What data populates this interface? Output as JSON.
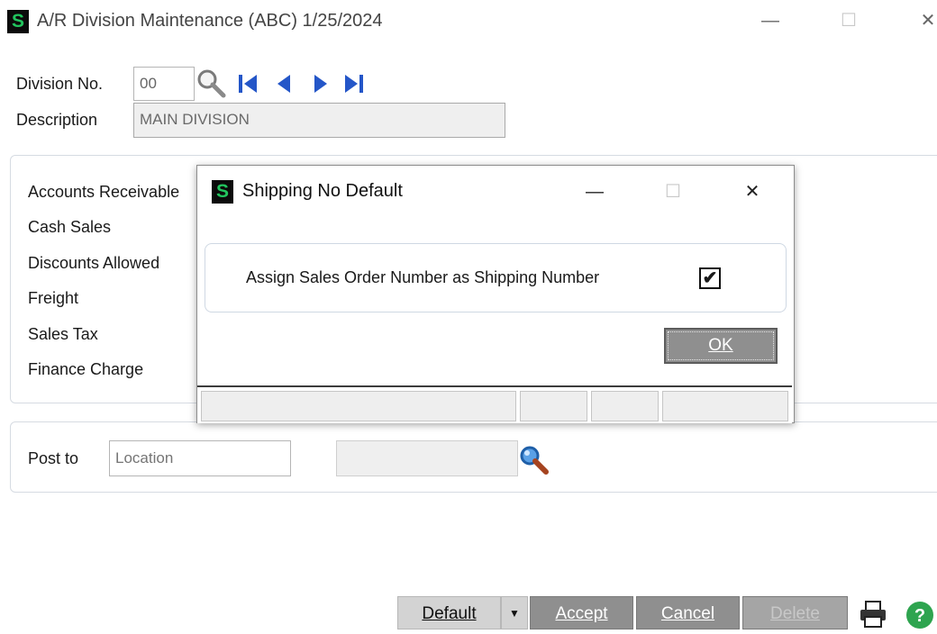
{
  "window": {
    "title": "A/R Division Maintenance (ABC) 1/25/2024",
    "logo_letter": "S",
    "controls": {
      "minimize": "—",
      "maximize": "☐",
      "close": "✕"
    }
  },
  "form": {
    "division_label": "Division No.",
    "division_value": "00",
    "description_label": "Description",
    "description_value": "MAIN DIVISION"
  },
  "accounts": {
    "items": [
      "Accounts Receivable",
      "Cash Sales",
      "Discounts Allowed",
      "Freight",
      "Sales Tax",
      "Finance Charge"
    ]
  },
  "post_to": {
    "label": "Post to",
    "location_placeholder": "Location"
  },
  "dialog": {
    "title": "Shipping No Default",
    "logo_letter": "S",
    "controls": {
      "minimize": "—",
      "maximize": "☐",
      "close": "✕"
    },
    "option_label": "Assign Sales Order Number as Shipping Number",
    "option_checked": true,
    "check_glyph": "✔",
    "ok_label": "OK"
  },
  "buttons": {
    "default": "Default",
    "dropdown_glyph": "▼",
    "accept": "Accept",
    "cancel": "Cancel",
    "delete": "Delete"
  },
  "colors": {
    "logo_bg": "#0b0b0b",
    "logo_fg": "#22c55e",
    "nav_blue": "#2456c8",
    "button_gray": "#8f8f8f"
  }
}
